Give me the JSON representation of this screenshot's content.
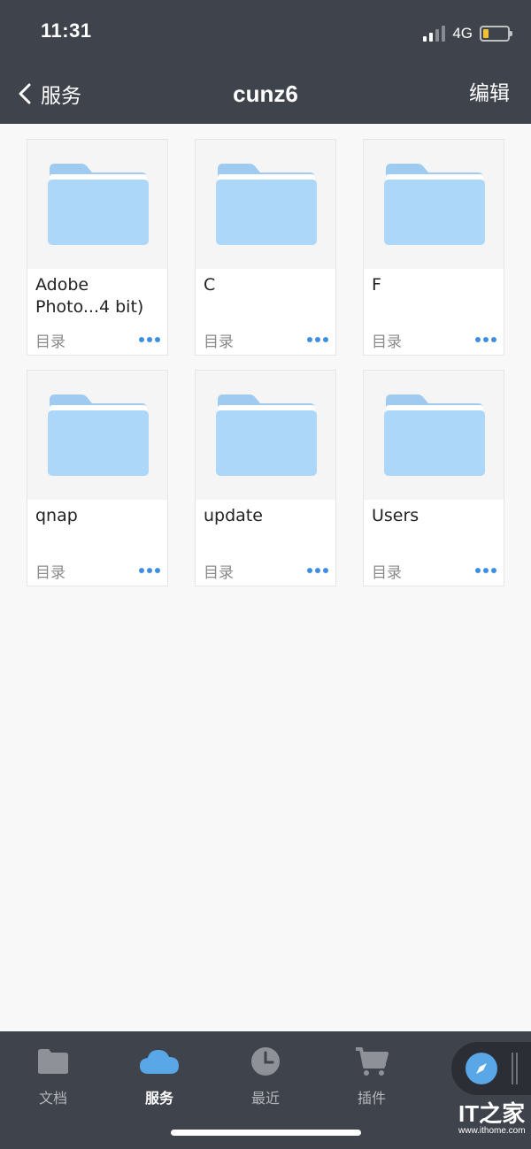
{
  "status_bar": {
    "time": "11:31",
    "network": "4G"
  },
  "nav": {
    "back_label": "服务",
    "title": "cunz6",
    "edit_label": "编辑"
  },
  "colors": {
    "header_bg": "#3f434c",
    "folder": "#acd7f8",
    "accent": "#3d8fe5",
    "battery": "#f1c232"
  },
  "items": [
    {
      "name": "Adobe\nPhoto...4 bit)",
      "type": "目录"
    },
    {
      "name": "C",
      "type": "目录"
    },
    {
      "name": "F",
      "type": "目录"
    },
    {
      "name": "qnap",
      "type": "目录"
    },
    {
      "name": "update",
      "type": "目录"
    },
    {
      "name": "Users",
      "type": "目录"
    }
  ],
  "tabs": [
    {
      "label": "文档",
      "icon": "folder-icon",
      "active": false
    },
    {
      "label": "服务",
      "icon": "cloud-icon",
      "active": true
    },
    {
      "label": "最近",
      "icon": "clock-icon",
      "active": false
    },
    {
      "label": "插件",
      "icon": "cart-icon",
      "active": false
    }
  ],
  "floating_button": {
    "icon": "compass-icon"
  },
  "watermark": {
    "logo": "IT之家",
    "url": "www.ithome.com"
  }
}
